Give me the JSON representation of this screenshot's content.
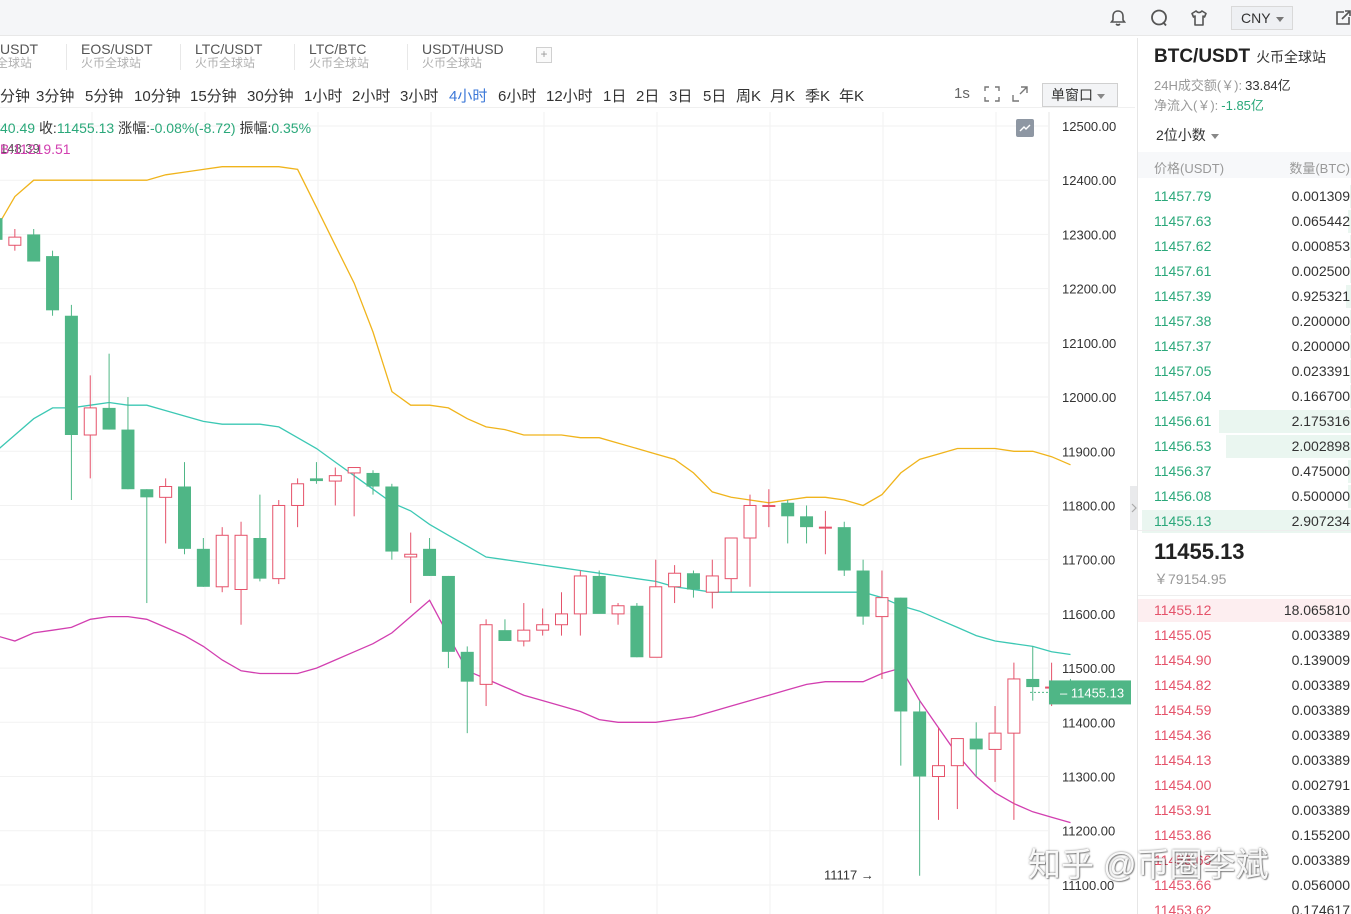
{
  "topbar": {
    "icons": [
      "bell-icon",
      "chat-icon",
      "shirt-icon",
      "export-icon"
    ],
    "currency": "CNY"
  },
  "tabs": [
    {
      "pair": "USDT",
      "venue": "火币全球站"
    },
    {
      "pair": "EOS/USDT",
      "venue": "火币全球站"
    },
    {
      "pair": "LTC/USDT",
      "venue": "火币全球站"
    },
    {
      "pair": "LTC/BTC",
      "venue": "火币全球站"
    },
    {
      "pair": "USDT/HUSD",
      "venue": "火币全球站"
    }
  ],
  "tab_add": "+",
  "intervals": [
    "分钟",
    "3分钟",
    "5分钟",
    "10分钟",
    "15分钟",
    "30分钟",
    "1小时",
    "2小时",
    "3小时",
    "4小时",
    "6小时",
    "12小时",
    "1日",
    "2日",
    "3日",
    "5日",
    "周K",
    "月K",
    "季K",
    "年K"
  ],
  "active_interval": "4小时",
  "interval_speed": "1s",
  "window_mode": "单窗口",
  "legend": {
    "open_value": "40.49",
    "close_label": "收:",
    "close_value": "11455.13",
    "change_label": "涨幅:",
    "change_value": "-0.08%(-8.72)",
    "amp_label": "振幅:",
    "amp_value": "0.35%",
    "boll_text": "B:11219.51",
    "overlap_text": "148.39"
  },
  "chart_data": {
    "type": "candlestick",
    "y_ticks": [
      12500,
      12400,
      12300,
      12200,
      12100,
      12000,
      11900,
      11800,
      11700,
      11600,
      11500,
      11400,
      11300,
      11200,
      11100
    ],
    "ylim": [
      11090,
      12530
    ],
    "candles": [
      [
        12330,
        12400,
        12280,
        12290
      ],
      [
        12280,
        12310,
        12270,
        12295
      ],
      [
        12300,
        12310,
        12250,
        12250
      ],
      [
        12260,
        12270,
        12150,
        12160
      ],
      [
        12150,
        12170,
        11810,
        11930
      ],
      [
        11930,
        12040,
        11850,
        11980
      ],
      [
        11980,
        12080,
        11940,
        11940
      ],
      [
        11940,
        12000,
        11830,
        11830
      ],
      [
        11830,
        11830,
        11620,
        11815
      ],
      [
        11815,
        11850,
        11730,
        11835
      ],
      [
        11835,
        11880,
        11710,
        11720
      ],
      [
        11720,
        11740,
        11650,
        11650
      ],
      [
        11650,
        11760,
        11640,
        11745
      ],
      [
        11645,
        11770,
        11580,
        11745
      ],
      [
        11740,
        11820,
        11660,
        11665
      ],
      [
        11665,
        11810,
        11655,
        11800
      ],
      [
        11800,
        11850,
        11760,
        11840
      ],
      [
        11850,
        11880,
        11840,
        11845
      ],
      [
        11845,
        11870,
        11800,
        11855
      ],
      [
        11860,
        11870,
        11780,
        11870
      ],
      [
        11860,
        11865,
        11820,
        11835
      ],
      [
        11835,
        11840,
        11700,
        11715
      ],
      [
        11705,
        11750,
        11620,
        11710
      ],
      [
        11720,
        11740,
        11670,
        11670
      ],
      [
        11670,
        11670,
        11500,
        11530
      ],
      [
        11530,
        11540,
        11380,
        11475
      ],
      [
        11470,
        11590,
        11430,
        11580
      ],
      [
        11570,
        11590,
        11550,
        11550
      ],
      [
        11550,
        11620,
        11540,
        11570
      ],
      [
        11570,
        11610,
        11560,
        11580
      ],
      [
        11580,
        11640,
        11560,
        11600
      ],
      [
        11600,
        11680,
        11560,
        11670
      ],
      [
        11670,
        11680,
        11610,
        11600
      ],
      [
        11600,
        11620,
        11580,
        11615
      ],
      [
        11615,
        11620,
        11520,
        11520
      ],
      [
        11520,
        11700,
        11520,
        11650
      ],
      [
        11650,
        11690,
        11620,
        11675
      ],
      [
        11675,
        11680,
        11630,
        11645
      ],
      [
        11640,
        11700,
        11610,
        11670
      ],
      [
        11665,
        11680,
        11640,
        11740
      ],
      [
        11740,
        11820,
        11650,
        11800
      ],
      [
        11800,
        11830,
        11760,
        11800
      ],
      [
        11805,
        11810,
        11730,
        11780
      ],
      [
        11780,
        11800,
        11730,
        11760
      ],
      [
        11760,
        11790,
        11710,
        11760
      ],
      [
        11760,
        11770,
        11670,
        11680
      ],
      [
        11680,
        11700,
        11580,
        11595
      ],
      [
        11595,
        11680,
        11480,
        11630
      ],
      [
        11630,
        11630,
        11320,
        11420
      ],
      [
        11420,
        11440,
        11117,
        11300
      ],
      [
        11300,
        11390,
        11220,
        11320
      ],
      [
        11320,
        11370,
        11240,
        11370
      ],
      [
        11370,
        11400,
        11300,
        11350
      ],
      [
        11350,
        11430,
        11290,
        11380
      ],
      [
        11380,
        11510,
        11220,
        11480
      ],
      [
        11480,
        11540,
        11440,
        11465
      ],
      [
        11465,
        11510,
        11430,
        11465
      ],
      [
        11470,
        11480,
        11440,
        11455
      ]
    ],
    "bands": {
      "upper": [
        12310,
        12370,
        12400,
        12400,
        12400,
        12400,
        12400,
        12400,
        12400,
        12410,
        12415,
        12420,
        12425,
        12425,
        12425,
        12425,
        12420,
        12350,
        12280,
        12210,
        12120,
        12010,
        11985,
        11985,
        11980,
        11960,
        11945,
        11940,
        11930,
        11930,
        11930,
        11925,
        11925,
        11915,
        11905,
        11895,
        11885,
        11860,
        11825,
        11815,
        11810,
        11805,
        11810,
        11815,
        11815,
        11810,
        11800,
        11820,
        11860,
        11885,
        11895,
        11905,
        11905,
        11905,
        11900,
        11900,
        11890,
        11875
      ],
      "middle": [
        11900,
        11930,
        11960,
        11980,
        11980,
        11985,
        11990,
        11985,
        11985,
        11975,
        11965,
        11955,
        11950,
        11950,
        11950,
        11945,
        11925,
        11905,
        11880,
        11855,
        11830,
        11805,
        11790,
        11765,
        11745,
        11725,
        11705,
        11700,
        11695,
        11690,
        11685,
        11680,
        11675,
        11670,
        11665,
        11660,
        11650,
        11645,
        11640,
        11640,
        11640,
        11640,
        11640,
        11640,
        11640,
        11640,
        11640,
        11630,
        11615,
        11605,
        11590,
        11575,
        11560,
        11550,
        11545,
        11540,
        11530,
        11525
      ],
      "lower": [
        11560,
        11550,
        11565,
        11570,
        11575,
        11590,
        11595,
        11595,
        11590,
        11575,
        11560,
        11540,
        11515,
        11495,
        11490,
        11490,
        11490,
        11500,
        11515,
        11530,
        11545,
        11565,
        11595,
        11625,
        11560,
        11495,
        11480,
        11465,
        11450,
        11440,
        11430,
        11420,
        11405,
        11400,
        11400,
        11400,
        11405,
        11410,
        11420,
        11430,
        11440,
        11450,
        11460,
        11470,
        11475,
        11475,
        11475,
        11490,
        11500,
        11440,
        11390,
        11340,
        11300,
        11270,
        11250,
        11235,
        11225,
        11215
      ]
    },
    "current_price": "11455.13",
    "low_marker": "11117"
  },
  "orderbook": {
    "pair": "BTC/USDT",
    "venue": "火币全球站",
    "vol_label": "24H成交额(￥):",
    "vol_value": "33.84亿",
    "flow_label": "净流入(￥):",
    "flow_value": "-1.85亿",
    "digits": "2位小数",
    "col_price": "价格(USDT)",
    "col_qty": "数量(BTC)",
    "asks": [
      {
        "price": "11457.79",
        "qty": "0.001309",
        "depth": 0.01
      },
      {
        "price": "11457.63",
        "qty": "0.065442",
        "depth": 0.02
      },
      {
        "price": "11457.62",
        "qty": "0.000853",
        "depth": 0.01
      },
      {
        "price": "11457.61",
        "qty": "0.002500",
        "depth": 0.01
      },
      {
        "price": "11457.39",
        "qty": "0.925321",
        "depth": 0.03
      },
      {
        "price": "11457.38",
        "qty": "0.200000",
        "depth": 0.01
      },
      {
        "price": "11457.37",
        "qty": "0.200000",
        "depth": 0.01
      },
      {
        "price": "11457.05",
        "qty": "0.023391",
        "depth": 0.01
      },
      {
        "price": "11457.04",
        "qty": "0.166700",
        "depth": 0.01
      },
      {
        "price": "11456.61",
        "qty": "2.175316",
        "depth": 0.62
      },
      {
        "price": "11456.53",
        "qty": "2.002898",
        "depth": 0.59
      },
      {
        "price": "11456.37",
        "qty": "0.475000",
        "depth": 0.02
      },
      {
        "price": "11456.08",
        "qty": "0.500000",
        "depth": 0.02
      },
      {
        "price": "11455.13",
        "qty": "2.907234",
        "depth": 0.98
      }
    ],
    "last_price": "11455.13",
    "last_cny": "￥79154.95",
    "bids": [
      {
        "price": "11455.12",
        "qty": "18.065810",
        "depth": 1.0
      },
      {
        "price": "11455.05",
        "qty": "0.003389",
        "depth": 0.0
      },
      {
        "price": "11454.90",
        "qty": "0.139009",
        "depth": 0.0
      },
      {
        "price": "11454.82",
        "qty": "0.003389",
        "depth": 0.0
      },
      {
        "price": "11454.59",
        "qty": "0.003389",
        "depth": 0.0
      },
      {
        "price": "11454.36",
        "qty": "0.003389",
        "depth": 0.0
      },
      {
        "price": "11454.13",
        "qty": "0.003389",
        "depth": 0.0
      },
      {
        "price": "11454.00",
        "qty": "0.002791",
        "depth": 0.0
      },
      {
        "price": "11453.91",
        "qty": "0.003389",
        "depth": 0.0
      },
      {
        "price": "11453.86",
        "qty": "0.155200",
        "depth": 0.0
      },
      {
        "price": "11453.66",
        "qty": "0.003389",
        "depth": 0.0
      },
      {
        "price": "11453.66",
        "qty": "0.056000",
        "depth": 0.0
      },
      {
        "price": "11453.62",
        "qty": "0.174617",
        "depth": 0.0
      }
    ]
  },
  "watermark": "知乎 @币圈李斌"
}
